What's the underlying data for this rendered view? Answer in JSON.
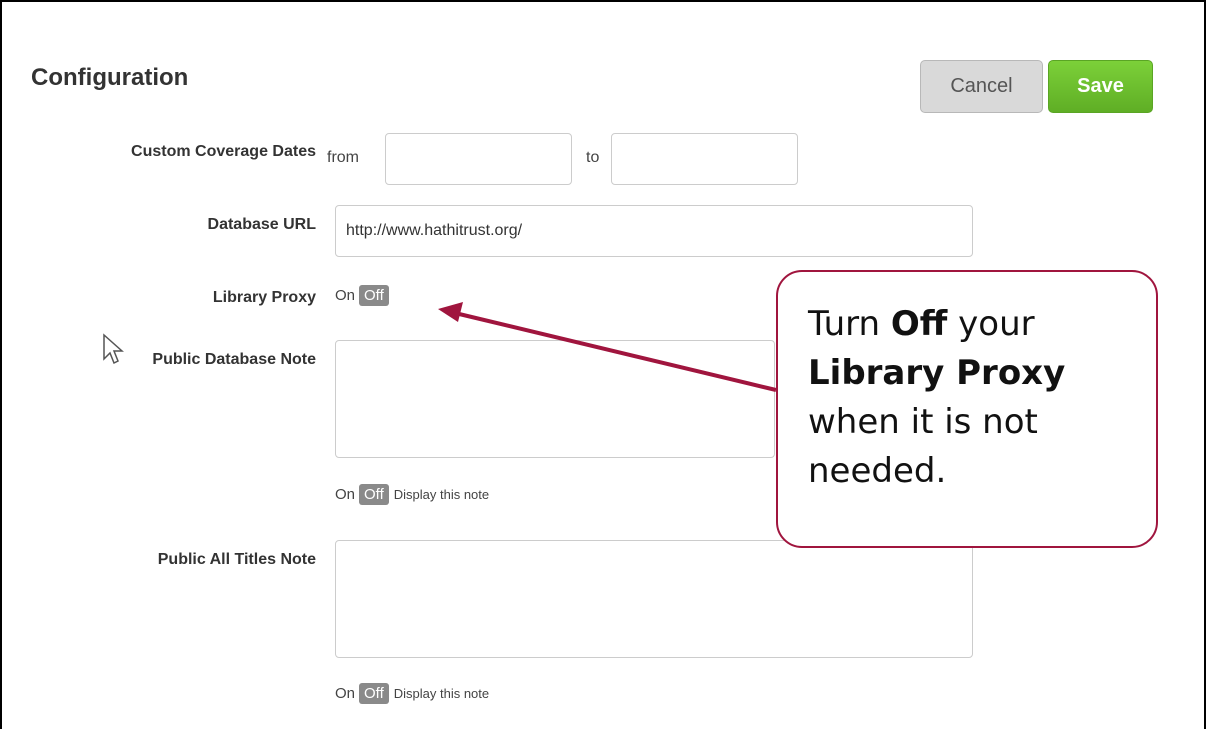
{
  "header": {
    "title": "Configuration",
    "cancel_label": "Cancel",
    "save_label": "Save"
  },
  "form": {
    "coverage": {
      "label": "Custom Coverage Dates",
      "from_text": "from",
      "to_text": "to",
      "from_value": "",
      "to_value": ""
    },
    "database_url": {
      "label": "Database URL",
      "value": "http://www.hathitrust.org/"
    },
    "library_proxy": {
      "label": "Library Proxy",
      "on_label": "On",
      "off_label": "Off"
    },
    "public_database_note": {
      "label": "Public Database Note",
      "value": "",
      "on_label": "On",
      "off_label": "Off",
      "display_text": "Display this note"
    },
    "public_all_titles_note": {
      "label": "Public All Titles Note",
      "value": "",
      "on_label": "On",
      "off_label": "Off",
      "display_text": "Display this note"
    }
  },
  "callout": {
    "part1": "Turn ",
    "bold1": "Off",
    "part2": " your ",
    "bold2": "Library Proxy",
    "part3": " when it is not needed."
  },
  "colors": {
    "callout_border": "#a0153e",
    "save_button": "#6cbf2e",
    "toggle_off": "#8a8a8a"
  }
}
